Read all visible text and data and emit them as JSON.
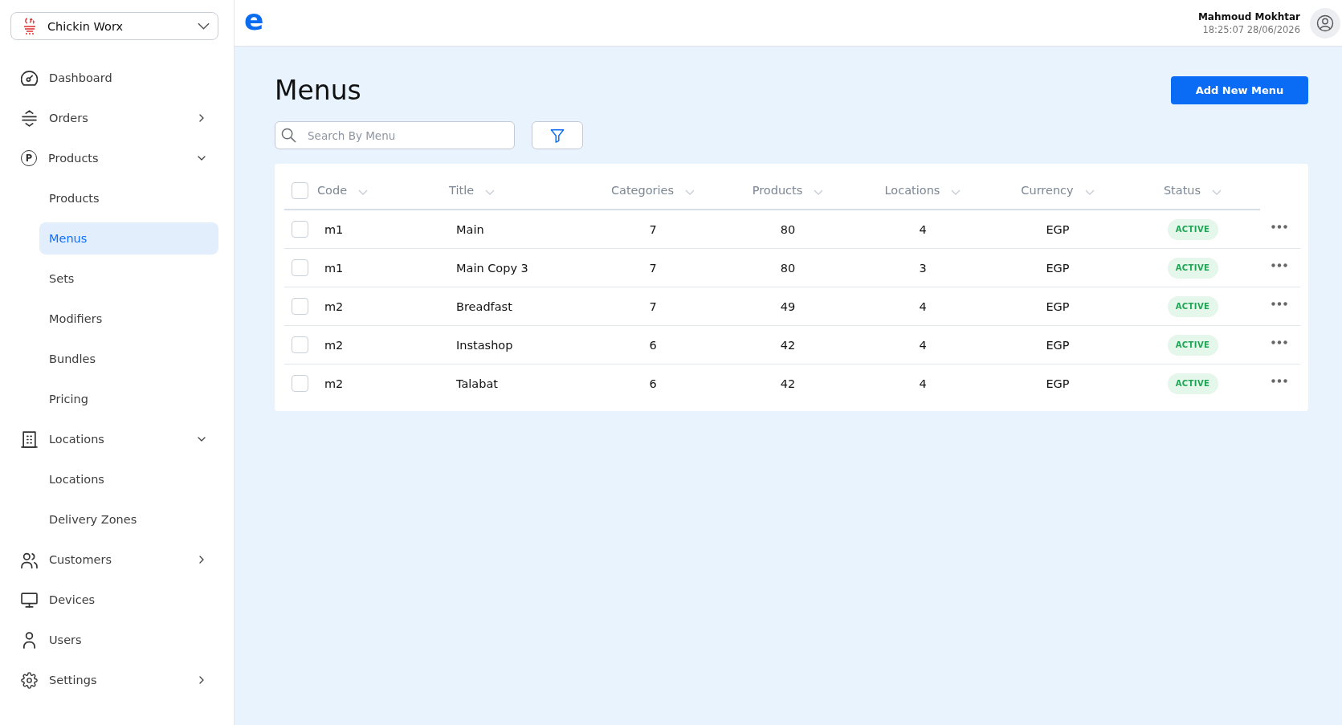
{
  "brand_selector": {
    "label": "Chickin Worx"
  },
  "sidebar": {
    "items": [
      {
        "kind": "link",
        "label": "Dashboard",
        "selected": false
      },
      {
        "kind": "group",
        "label": "Orders",
        "selected": false,
        "expanded": false
      },
      {
        "kind": "group",
        "label": "Products",
        "icon_glyph": "P",
        "selected": false,
        "expanded": true,
        "children": [
          {
            "label": "Products",
            "selected": false
          },
          {
            "label": "Menus",
            "selected": true
          },
          {
            "label": "Sets",
            "selected": false
          },
          {
            "label": "Modifiers",
            "selected": false
          },
          {
            "label": "Bundles",
            "selected": false
          },
          {
            "label": "Pricing",
            "selected": false
          }
        ]
      },
      {
        "kind": "group",
        "label": "Locations",
        "selected": false,
        "expanded": true,
        "children": [
          {
            "label": "Locations",
            "selected": false
          },
          {
            "label": "Delivery Zones",
            "selected": false
          }
        ]
      },
      {
        "kind": "group",
        "label": "Customers",
        "selected": false,
        "expanded": false
      },
      {
        "kind": "link",
        "label": "Devices",
        "selected": false
      },
      {
        "kind": "link",
        "label": "Users",
        "selected": false
      },
      {
        "kind": "group",
        "label": "Settings",
        "selected": false,
        "expanded": false
      }
    ]
  },
  "header": {
    "logo": "e",
    "user": {
      "name": "Mahmoud Mokhtar",
      "timestamp": "18:25:07 28/06/2026"
    }
  },
  "page": {
    "title": "Menus",
    "add_button": "Add New Menu",
    "search": {
      "placeholder": "Search By Menu"
    }
  },
  "table": {
    "select_all_checked": false,
    "columns": [
      "Code",
      "Title",
      "Categories",
      "Products",
      "Locations",
      "Currency",
      "Status"
    ],
    "rows": [
      {
        "checked": false,
        "cells": [
          "m1",
          "Main",
          "7",
          "80",
          "4",
          "EGP"
        ],
        "status": "ACTIVE"
      },
      {
        "checked": false,
        "cells": [
          "m1",
          "Main Copy 3",
          "7",
          "80",
          "3",
          "EGP"
        ],
        "status": "ACTIVE"
      },
      {
        "checked": false,
        "cells": [
          "m2",
          "Breadfast",
          "7",
          "49",
          "4",
          "EGP"
        ],
        "status": "ACTIVE"
      },
      {
        "checked": false,
        "cells": [
          "m2",
          "Instashop",
          "6",
          "42",
          "4",
          "EGP"
        ],
        "status": "ACTIVE"
      },
      {
        "checked": false,
        "cells": [
          "m2",
          "Talabat",
          "6",
          "42",
          "4",
          "EGP"
        ],
        "status": "ACTIVE"
      }
    ]
  }
}
